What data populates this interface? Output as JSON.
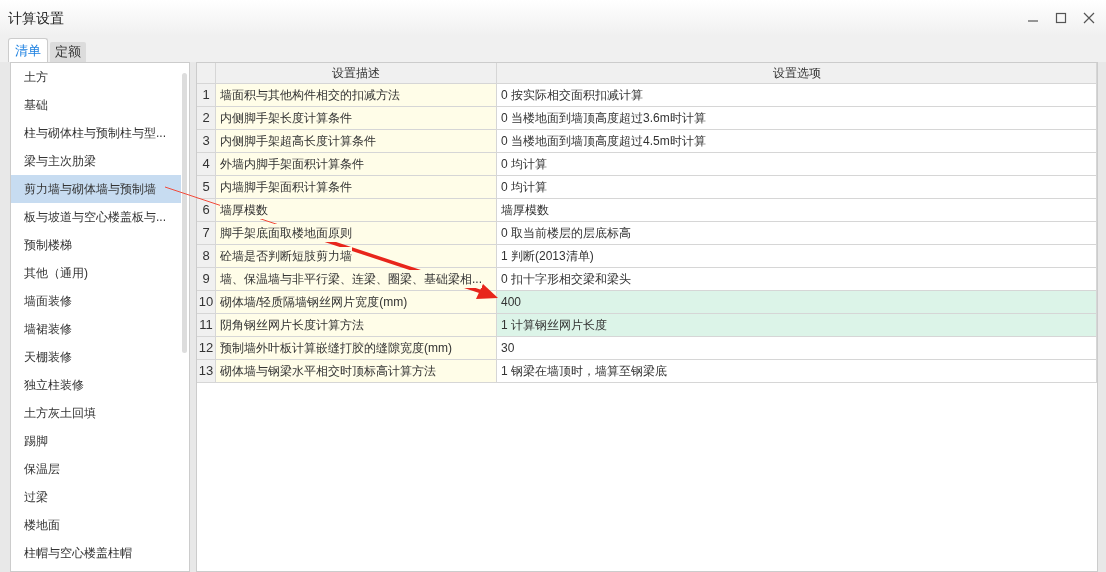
{
  "window": {
    "title": "计算设置"
  },
  "tabs": [
    {
      "label": "清单",
      "selected": true
    },
    {
      "label": "定额",
      "selected": false
    }
  ],
  "sidebar": {
    "items": [
      {
        "label": "土方",
        "selected": false
      },
      {
        "label": "基础",
        "selected": false
      },
      {
        "label": "柱与砌体柱与预制柱与型...",
        "selected": false
      },
      {
        "label": "梁与主次肋梁",
        "selected": false
      },
      {
        "label": "剪力墙与砌体墙与预制墙",
        "selected": true
      },
      {
        "label": "板与坡道与空心楼盖板与...",
        "selected": false
      },
      {
        "label": "预制楼梯",
        "selected": false
      },
      {
        "label": "其他（通用)",
        "selected": false
      },
      {
        "label": "墙面装修",
        "selected": false
      },
      {
        "label": "墙裙装修",
        "selected": false
      },
      {
        "label": "天棚装修",
        "selected": false
      },
      {
        "label": "独立柱装修",
        "selected": false
      },
      {
        "label": "土方灰土回填",
        "selected": false
      },
      {
        "label": "踢脚",
        "selected": false
      },
      {
        "label": "保温层",
        "selected": false
      },
      {
        "label": "过梁",
        "selected": false
      },
      {
        "label": "楼地面",
        "selected": false
      },
      {
        "label": "柱帽与空心楼盖柱帽",
        "selected": false
      }
    ]
  },
  "table": {
    "columns": [
      "设置描述",
      "设置选项"
    ],
    "rows": [
      {
        "index": "1",
        "description": "墙面积与其他构件相交的扣减方法",
        "option": "0 按实际相交面积扣减计算",
        "highlighted": false
      },
      {
        "index": "2",
        "description": "内侧脚手架长度计算条件",
        "option": "0 当楼地面到墙顶高度超过3.6m时计算",
        "highlighted": false
      },
      {
        "index": "3",
        "description": "内侧脚手架超高长度计算条件",
        "option": "0 当楼地面到墙顶高度超过4.5m时计算",
        "highlighted": false
      },
      {
        "index": "4",
        "description": "外墙内脚手架面积计算条件",
        "option": "0 均计算",
        "highlighted": false
      },
      {
        "index": "5",
        "description": "内墙脚手架面积计算条件",
        "option": "0 均计算",
        "highlighted": false
      },
      {
        "index": "6",
        "description": "墙厚模数",
        "option": "墙厚模数",
        "highlighted": false
      },
      {
        "index": "7",
        "description": "脚手架底面取楼地面原则",
        "option": "0 取当前楼层的层底标高",
        "highlighted": false
      },
      {
        "index": "8",
        "description": "砼墙是否判断短肢剪力墙",
        "option": "1 判断(2013清单)",
        "highlighted": false
      },
      {
        "index": "9",
        "description": "墙、保温墙与非平行梁、连梁、圈梁、基础梁相...",
        "option": "0 扣十字形相交梁和梁头",
        "highlighted": false
      },
      {
        "index": "10",
        "description": "砌体墙/轻质隔墙钢丝网片宽度(mm)",
        "option": "400",
        "highlighted": true
      },
      {
        "index": "11",
        "description": "阴角钢丝网片长度计算方法",
        "option": "1 计算钢丝网片长度",
        "highlighted": true
      },
      {
        "index": "12",
        "description": "预制墙外叶板计算嵌缝打胶的缝隙宽度(mm)",
        "option": "30",
        "highlighted": false
      },
      {
        "index": "13",
        "description": "砌体墙与钢梁水平相交时顶标高计算方法",
        "option": "1 钢梁在墙顶时，墙算至钢梁底",
        "highlighted": false
      }
    ]
  }
}
